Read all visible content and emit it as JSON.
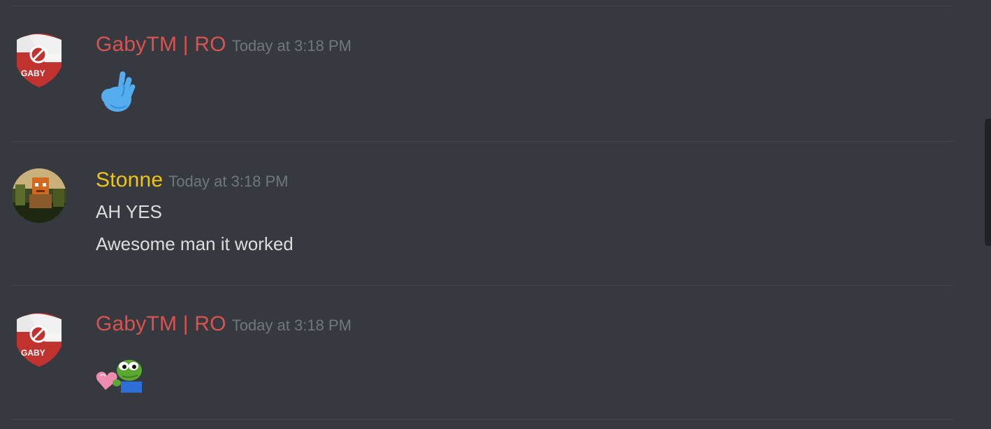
{
  "messages": [
    {
      "username": "GabyTM | RO",
      "timestamp": "Today at 3:18 PM",
      "avatar_text": "GABY",
      "content_icon": "ok-hand-emoji"
    },
    {
      "username": "Stonne",
      "timestamp": "Today at 3:18 PM",
      "avatar_icon": "pixel-character-avatar",
      "lines": [
        "AH YES",
        "Awesome man it worked"
      ]
    },
    {
      "username": "GabyTM | RO",
      "timestamp": "Today at 3:18 PM",
      "avatar_text": "GABY",
      "content_icon": "pepe-heart-emoji"
    }
  ],
  "colors": {
    "background": "#36393f",
    "gaby_name": "#d9534f",
    "stonne_name": "#f1c40f",
    "timestamp": "#72767d",
    "text": "#dcddde"
  }
}
